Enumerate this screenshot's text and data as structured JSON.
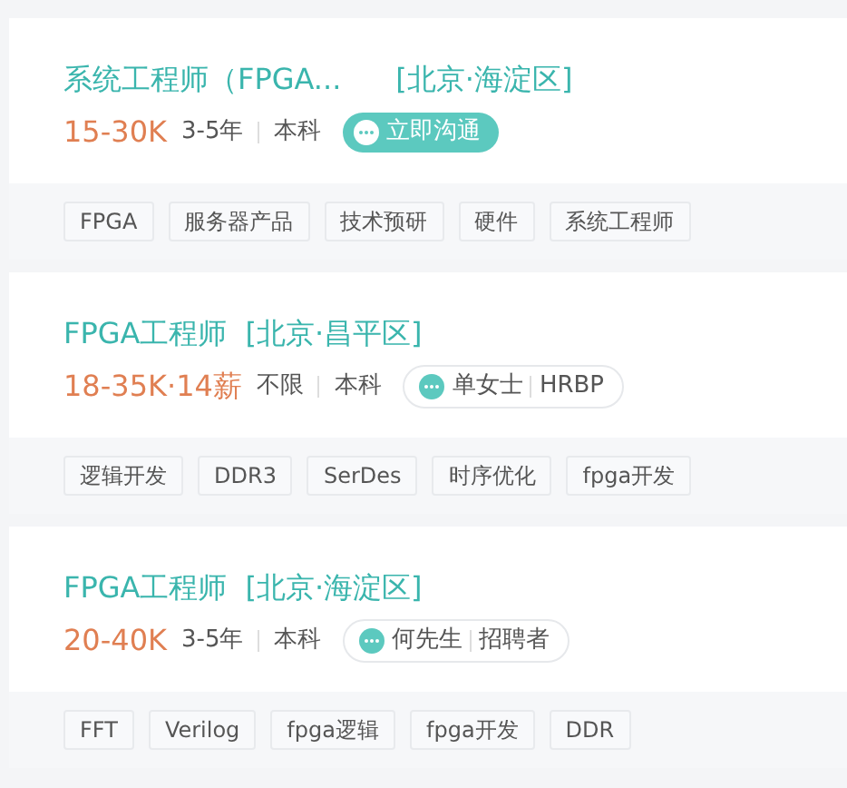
{
  "jobs": [
    {
      "title": "系统工程师（FPGA...",
      "location": "[北京·海淀区]",
      "salary": "15-30K",
      "experience": "3-5年",
      "education": "本科",
      "contact": {
        "kind": "chat",
        "label": "立即沟通"
      },
      "tags": [
        "FPGA",
        "服务器产品",
        "技术预研",
        "硬件",
        "系统工程师"
      ]
    },
    {
      "title": "FPGA工程师",
      "location": "[北京·昌平区]",
      "salary": "18-35K·14薪",
      "experience": "不限",
      "education": "本科",
      "contact": {
        "kind": "recruiter",
        "name": "单女士",
        "role": "HRBP"
      },
      "tags": [
        "逻辑开发",
        "DDR3",
        "SerDes",
        "时序优化",
        "fpga开发"
      ]
    },
    {
      "title": "FPGA工程师",
      "location": "[北京·海淀区]",
      "salary": "20-40K",
      "experience": "3-5年",
      "education": "本科",
      "contact": {
        "kind": "recruiter",
        "name": "何先生",
        "role": "招聘者"
      },
      "tags": [
        "FFT",
        "Verilog",
        "fpga逻辑",
        "fpga开发",
        "DDR"
      ]
    }
  ]
}
